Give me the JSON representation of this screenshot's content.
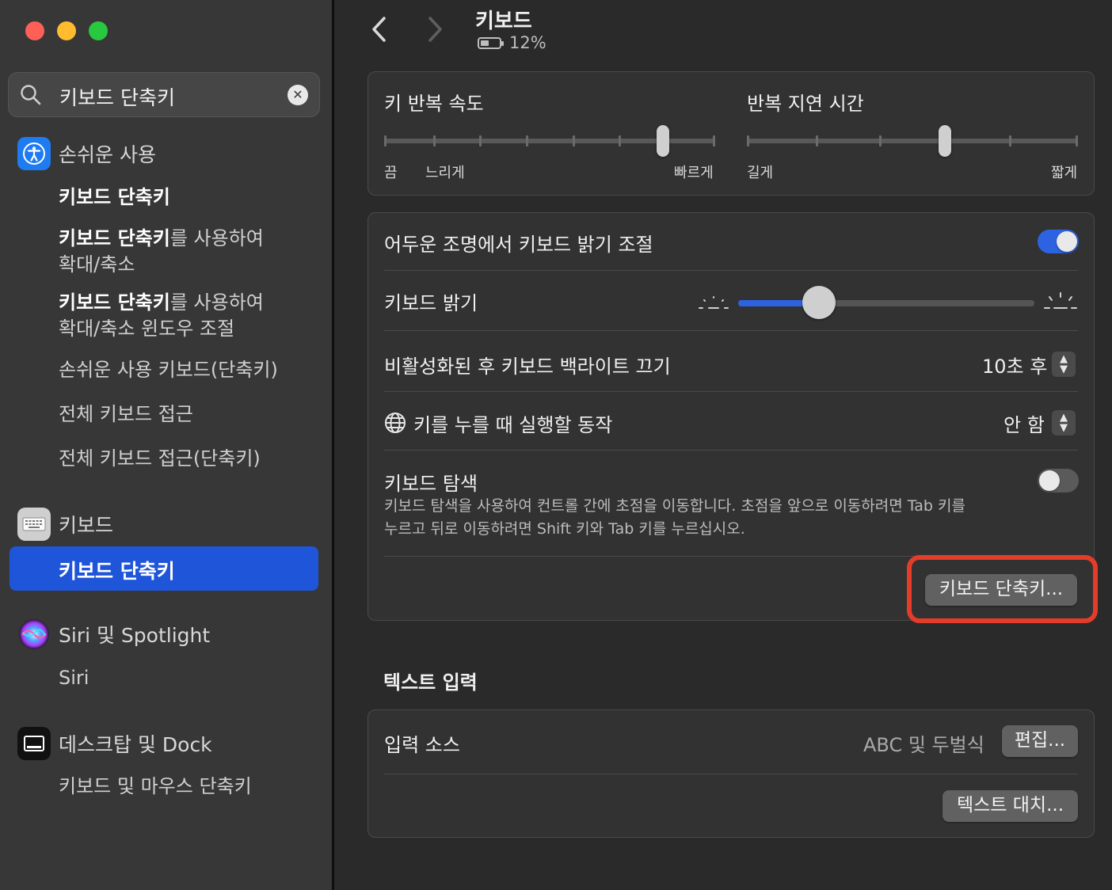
{
  "sidebar": {
    "search_value": "키보드 단축키",
    "groups": [
      {
        "label": "손쉬운 사용",
        "icon": "accessibility-icon",
        "items": [
          {
            "bold": "키보드 단축키",
            "rest": ""
          },
          {
            "bold": "키보드 단축키",
            "rest": "를 사용하여",
            "line2": "확대/축소"
          },
          {
            "bold": "키보드 단축키",
            "rest": "를 사용하여",
            "line2": "확대/축소 윈도우 조절"
          },
          {
            "bold": "",
            "rest": "손쉬운 사용 키보드(단축키)"
          },
          {
            "bold": "",
            "rest": "전체 키보드 접근"
          },
          {
            "bold": "",
            "rest": "전체 키보드 접근(단축키)"
          }
        ]
      },
      {
        "label": "키보드",
        "icon": "keyboard-icon",
        "selected_item": "키보드 단축키"
      },
      {
        "label": "Siri 및 Spotlight",
        "icon": "siri-icon",
        "items": [
          {
            "rest": "Siri"
          }
        ]
      },
      {
        "label": "데스크탑 및 Dock",
        "icon": "dock-icon",
        "items": [
          {
            "rest": "키보드 및 마우스 단축키"
          }
        ]
      }
    ]
  },
  "header": {
    "title": "키보드",
    "battery": "12%"
  },
  "repeat": {
    "rate_label": "키 반복 속도",
    "rate_min_off": "끔",
    "rate_slow": "느리게",
    "rate_fast": "빠르게",
    "rate_level": 0.83,
    "delay_label": "반복 지연 시간",
    "delay_long": "길게",
    "delay_short": "짧게",
    "delay_level": 0.6
  },
  "backlight": {
    "auto_label": "어두운 조명에서 키보드 밝기 조절",
    "auto_on": true,
    "brightness_label": "키보드 밝기",
    "brightness_level": 0.27,
    "off_after_label": "비활성화된 후 키보드 백라이트 끄기",
    "off_after_value": "10초 후",
    "globe_label": "키를 누를 때 실행할 동작",
    "globe_value": "안 함",
    "nav_label": "키보드 탐색",
    "nav_on": false,
    "nav_desc_1": "키보드 탐색을 사용하여 컨트롤 간에 초점을 이동합니다. 초점을 앞으로 이동하려면 Tab 키를",
    "nav_desc_2": "누르고 뒤로 이동하려면 Shift 키와 Tab 키를 누르십시오.",
    "shortcuts_button": "키보드 단축키..."
  },
  "text_input": {
    "section_title": "텍스트 입력",
    "source_label": "입력 소스",
    "source_value": "ABC 및 두벌식",
    "edit_button": "편집...",
    "replace_button": "텍스트 대치..."
  },
  "colors": {
    "accent": "#2d62e0",
    "selection": "#1f55d9",
    "highlight_ring": "#e33d2a"
  }
}
